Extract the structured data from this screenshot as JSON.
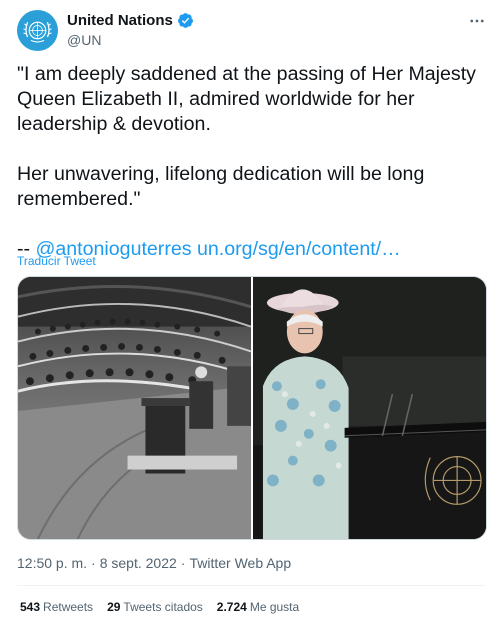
{
  "account": {
    "name": "United Nations",
    "handle": "@UN",
    "verified": true
  },
  "tweet": {
    "paragraph1": "\"I am deeply saddened at the passing of Her Majesty Queen Elizabeth II, admired worldwide for her leadership & devotion.",
    "paragraph2": "Her unwavering, lifelong dedication will be long remembered.\"",
    "signature_prefix": "-- ",
    "mention": "@antonioguterres",
    "url": "un.org/sg/en/content/…",
    "translate_label": "Traducir Tweet"
  },
  "meta": {
    "time": "12:50 p. m.",
    "separator": "·",
    "date": "8 sept. 2022",
    "source": "Twitter Web App"
  },
  "stats": {
    "retweets_count": "543",
    "retweets_label": "Retweets",
    "quotes_count": "29",
    "quotes_label": "Tweets citados",
    "likes_count": "2.724",
    "likes_label": "Me gusta"
  },
  "icons": {
    "avatar": "un-emblem-icon",
    "verified": "verified-badge-icon",
    "more": "more-options-icon"
  },
  "colors": {
    "link": "#1d9bf0",
    "un_blue": "#2a9fd8",
    "secondary_text": "#536471"
  }
}
